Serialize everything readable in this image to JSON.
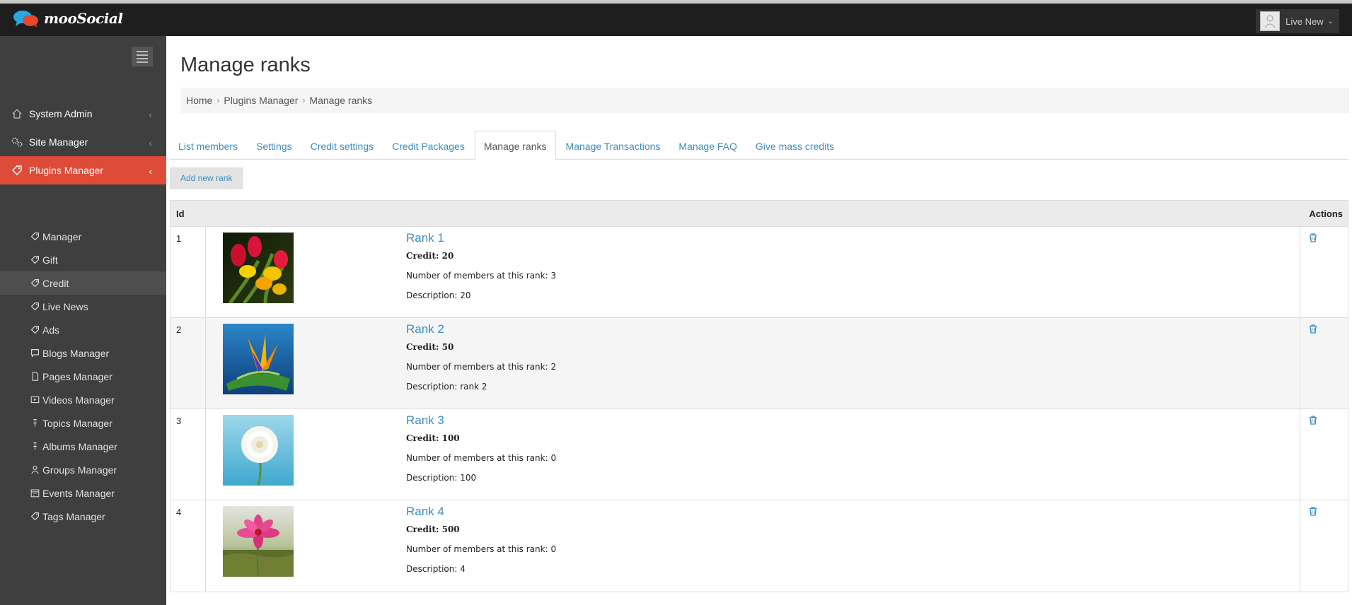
{
  "app": {
    "brand": "mooSocial",
    "accent": "#de4b39",
    "link_color": "#3c8dbc"
  },
  "header": {
    "user_name": "Live New",
    "user_icon": "user-avatar-icon",
    "caret_icon": "chevron-down-icon"
  },
  "sidebar": {
    "menu_icon": "hamburger-icon",
    "top_items": [
      {
        "label": "System Admin",
        "icon": "home-icon"
      },
      {
        "label": "Site Manager",
        "icon": "gears-icon"
      },
      {
        "label": "Plugins Manager",
        "icon": "tag-icon",
        "active": true
      }
    ],
    "sub_items": [
      {
        "label": "Manager",
        "icon": "tag-icon"
      },
      {
        "label": "Gift",
        "icon": "tag-icon"
      },
      {
        "label": "Credit",
        "icon": "tag-icon",
        "selected": true
      },
      {
        "label": "Live News",
        "icon": "tag-icon"
      },
      {
        "label": "Ads",
        "icon": "tag-icon"
      },
      {
        "label": "Blogs Manager",
        "icon": "comment-icon"
      },
      {
        "label": "Pages Manager",
        "icon": "file-icon"
      },
      {
        "label": "Videos Manager",
        "icon": "video-icon"
      },
      {
        "label": "Topics Manager",
        "icon": "pin-icon"
      },
      {
        "label": "Albums Manager",
        "icon": "pin-icon"
      },
      {
        "label": "Groups Manager",
        "icon": "group-icon"
      },
      {
        "label": "Events Manager",
        "icon": "calendar-icon"
      },
      {
        "label": "Tags Manager",
        "icon": "tag-icon"
      }
    ]
  },
  "main": {
    "title": "Manage ranks",
    "breadcrumb": [
      "Home",
      "Plugins Manager",
      "Manage ranks"
    ],
    "tabs": [
      {
        "label": "List members"
      },
      {
        "label": "Settings"
      },
      {
        "label": "Credit settings"
      },
      {
        "label": "Credit Packages"
      },
      {
        "label": "Manage ranks",
        "active": true
      },
      {
        "label": "Manage Transactions"
      },
      {
        "label": "Manage FAQ"
      },
      {
        "label": "Give mass credits"
      }
    ],
    "add_button": "Add new rank",
    "table": {
      "headers": {
        "id": "Id",
        "actions": "Actions"
      },
      "rows": [
        {
          "id": "1",
          "name": "Rank 1",
          "credit": "Credit: 20",
          "members": "Number of members at this rank: 3",
          "description": "Description: 20",
          "image": "tulips"
        },
        {
          "id": "2",
          "name": "Rank 2",
          "credit": "Credit: 50",
          "members": "Number of members at this rank: 2",
          "description": "Description: rank 2",
          "image": "bird-of-paradise"
        },
        {
          "id": "3",
          "name": "Rank 3",
          "credit": "Credit: 100",
          "members": "Number of members at this rank: 0",
          "description": "Description: 100",
          "image": "white-dahlia"
        },
        {
          "id": "4",
          "name": "Rank 4",
          "credit": "Credit: 500",
          "members": "Number of members at this rank: 0",
          "description": "Description: 4",
          "image": "pink-cosmos"
        }
      ]
    }
  }
}
